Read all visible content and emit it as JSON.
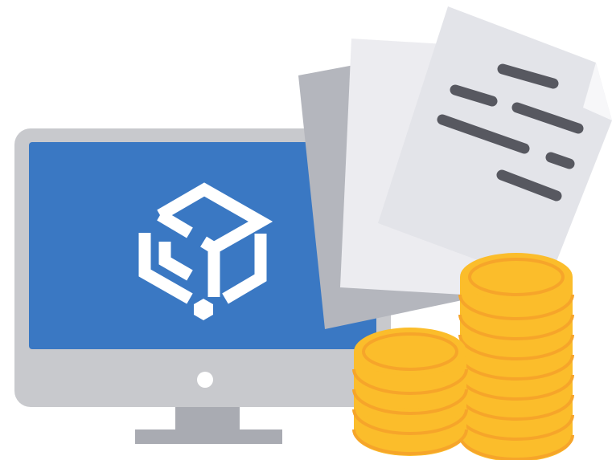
{
  "illustration": {
    "colors": {
      "background": "#ffffff",
      "monitor_frame": "#c8c9cd",
      "monitor_screen": "#3a78c3",
      "monitor_stand": "#a9abb2",
      "power_dot": "#ffffff",
      "box_logo": "#ffffff",
      "paper_back": "#b4b6bd",
      "paper_middle": "#ececf0",
      "paper_front": "#e3e4e9",
      "paper_fold": "#f7f7f9",
      "text_lines": "#575860",
      "coin_face": "#fbbd2b",
      "coin_edge": "#f6a52a",
      "coin_shine": "#fcd052"
    },
    "icons": [
      "desktop-monitor-icon",
      "box-logo-icon",
      "document-stack-icon",
      "coin-stack-icon"
    ]
  }
}
